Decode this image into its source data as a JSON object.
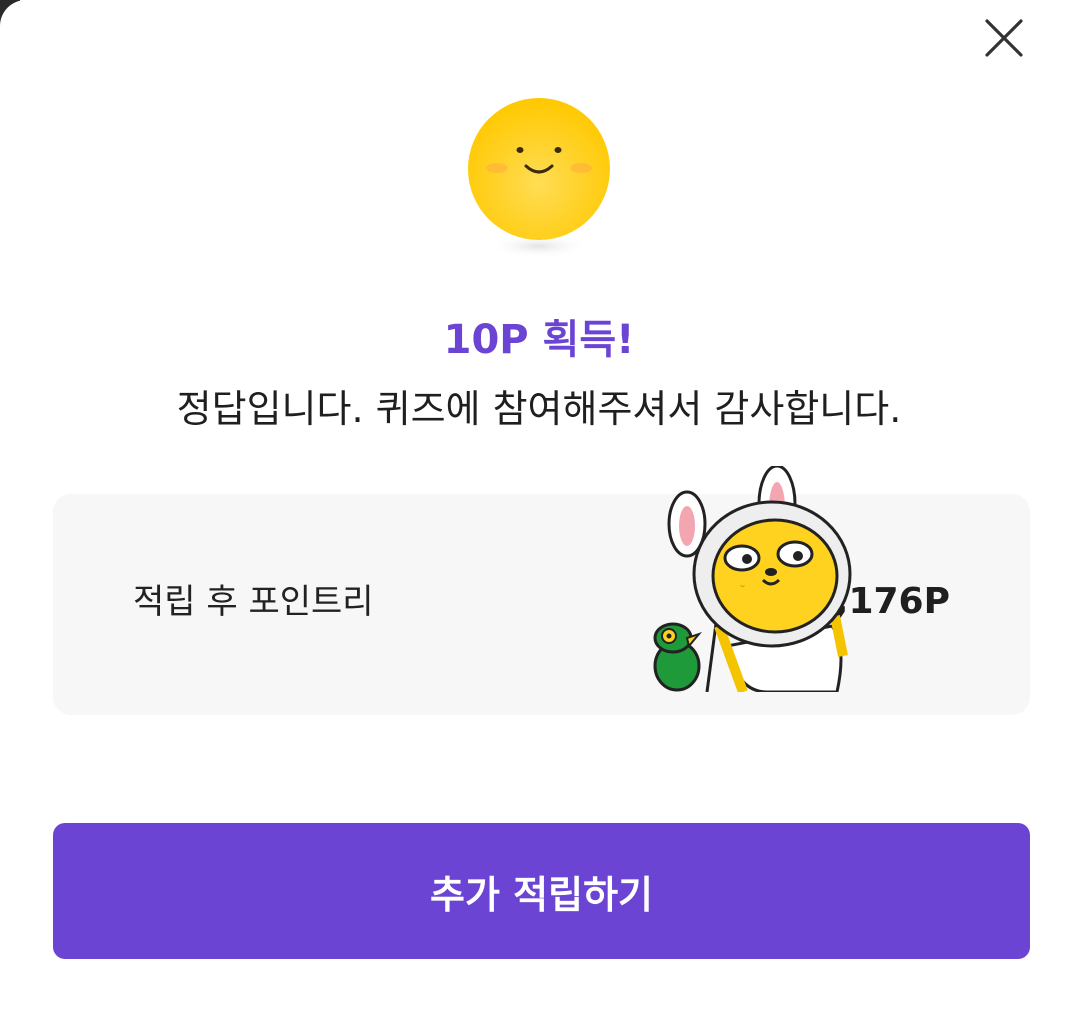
{
  "modal": {
    "close_icon": "close-icon",
    "sun_icon": "smiling-sun-icon",
    "title": "10P 획득!",
    "message": "정답입니다. 퀴즈에 참여해주셔서 감사합니다."
  },
  "points_card": {
    "label": "적립 후 포인트리",
    "value": ",176P",
    "sticker_icon": "character-sticker-icon"
  },
  "cta": {
    "label": "추가 적립하기"
  },
  "colors": {
    "accent": "#6b44d4",
    "sun": "#ffcc00",
    "card_bg": "#f7f7f7"
  }
}
